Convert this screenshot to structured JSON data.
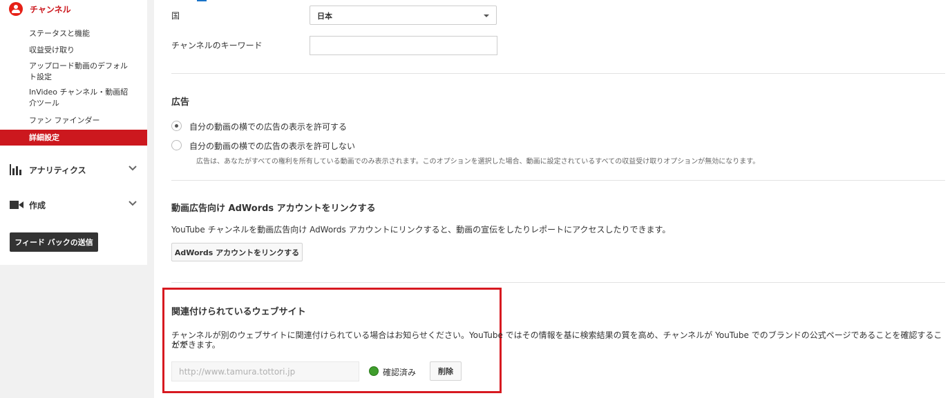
{
  "sidebar": {
    "channel_label": "チャンネル",
    "items": [
      {
        "label": "ステータスと機能"
      },
      {
        "label": "収益受け取り"
      },
      {
        "label": "アップロード動画のデフォルト設定"
      },
      {
        "label": "InVideo チャンネル・動画紹介ツール"
      },
      {
        "label": "ファン ファインダー"
      },
      {
        "label": "詳細設定"
      }
    ],
    "analytics_label": "アナリティクス",
    "create_label": "作成",
    "feedback_label": "フィード バックの送信"
  },
  "main": {
    "country_label": "国",
    "country_value": "日本",
    "keywords_label": "チャンネルのキーワード",
    "keywords_value": "",
    "ads": {
      "heading": "広告",
      "option_allow": "自分の動画の横での広告の表示を許可する",
      "option_disallow": "自分の動画の横での広告の表示を許可しない",
      "note": "広告は、あなたがすべての権利を所有している動画でのみ表示されます。このオプションを選択した場合、動画に設定されているすべての収益受け取りオプションが無効になります。",
      "selected": "allow"
    },
    "adwords": {
      "heading": "動画広告向け AdWords アカウントをリンクする",
      "body": "YouTube チャンネルを動画広告向け AdWords アカウントにリンクすると、動画の宣伝をしたりレポートにアクセスしたりできます。",
      "button": "AdWords アカウントをリンクする"
    },
    "website": {
      "heading": "関連付けられているウェブサイト",
      "body_line1": "チャンネルが別のウェブサイトに関連付けられている場合はお知らせください。YouTube ではその情報を基に検索結果の質を高め、チャンネルが YouTube でのブランドの公式ページであることを確認することが",
      "body_line2": "ができます。",
      "url_placeholder": "http://www.tamura.tottori.jp",
      "status": "確認済み",
      "delete_button": "削除",
      "status_color": "#3f9d2c"
    }
  }
}
